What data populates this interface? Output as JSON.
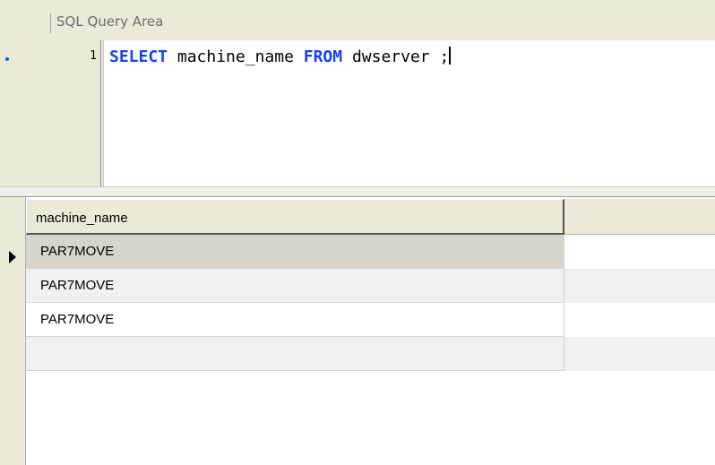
{
  "query_area": {
    "title": "SQL Query Area",
    "line_number": "1",
    "code": {
      "kw1": "SELECT",
      "t1": " machine_name ",
      "kw2": "FROM",
      "t2": " dwserver ;"
    }
  },
  "results": {
    "columns": [
      "machine_name"
    ],
    "rows": [
      {
        "machine_name": "PAR7MOVE",
        "selected": true
      },
      {
        "machine_name": "PAR7MOVE"
      },
      {
        "machine_name": "PAR7MOVE"
      },
      {
        "machine_name": ""
      }
    ]
  }
}
